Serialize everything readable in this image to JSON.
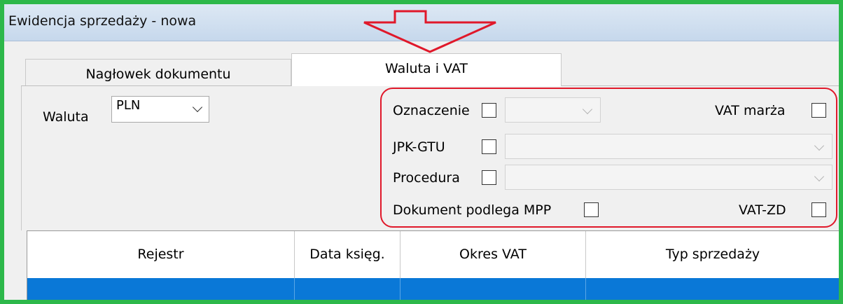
{
  "window": {
    "title": "Ewidencja sprzedaży - nowa"
  },
  "tabs": [
    {
      "label": "Nagłowek dokumentu",
      "active": false
    },
    {
      "label": "Waluta i VAT",
      "active": true
    }
  ],
  "currency": {
    "label": "Waluta",
    "value": "PLN"
  },
  "vat_fields": {
    "oznaczenie_label": "Oznaczenie",
    "vat_marza_label": "VAT marża",
    "jpk_gtu_label": "JPK-GTU",
    "procedura_label": "Procedura",
    "mpp_label": "Dokument podlega MPP",
    "vat_zd_label": "VAT-ZD"
  },
  "table": {
    "columns": [
      "Rejestr",
      "Data księg.",
      "Okres VAT",
      "Typ sprzedaży"
    ]
  },
  "colors": {
    "highlight_border": "#e0182a",
    "arrow": "#e0182a",
    "frame": "#2db84a",
    "selected_row": "#0a78d7"
  }
}
